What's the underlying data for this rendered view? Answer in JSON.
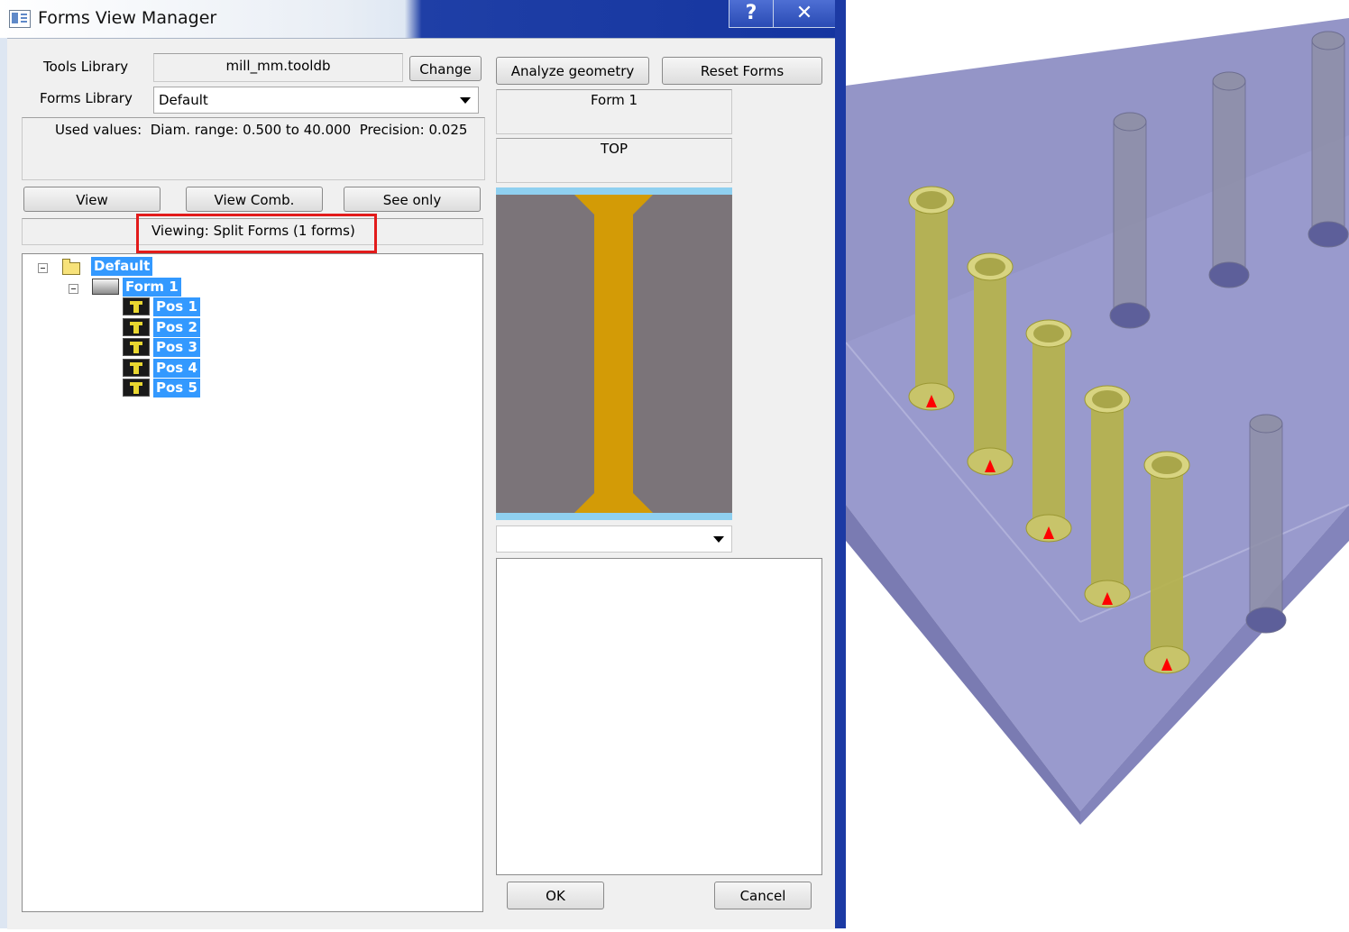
{
  "window": {
    "title": "Forms View Manager",
    "help_label": "?",
    "close_label": "✕"
  },
  "libraries": {
    "tools_library_label": "Tools Library",
    "tools_library_value": "mill_mm.tooldb",
    "change_label": "Change",
    "forms_library_label": "Forms Library",
    "forms_library_value": "Default"
  },
  "used_values": "Used values:  Diam. range: 0.500 to 40.000  Precision: 0.025",
  "view_buttons": {
    "view": "View",
    "view_comb": "View Comb.",
    "see_only": "See only"
  },
  "viewing_status": "Viewing: Split Forms (1 forms)",
  "tree": {
    "root": "Default",
    "form": "Form 1",
    "positions": [
      "Pos 1",
      "Pos 2",
      "Pos 3",
      "Pos 4",
      "Pos 5"
    ]
  },
  "right_panel": {
    "analyze_label": "Analyze geometry",
    "reset_label": "Reset Forms",
    "form_name": "Form 1",
    "face": "TOP",
    "dropdown_value": ""
  },
  "footer": {
    "ok_label": "OK",
    "cancel_label": "Cancel"
  },
  "colors": {
    "selection": "#3399ff",
    "highlight_box": "#e21b1b",
    "form_profile": "#d39b06",
    "form_background": "#7b7479",
    "form_edges": "#8fd0f0",
    "block": "#8e8fc4",
    "drilled_holes": "#b7b448",
    "empty_holes": "#8f90a8",
    "position_markers": "#ff0000"
  },
  "icons": [
    "help-icon",
    "close-icon",
    "folder-icon",
    "form-icon",
    "position-icon",
    "dropdown-arrow-icon",
    "app-icon"
  ]
}
